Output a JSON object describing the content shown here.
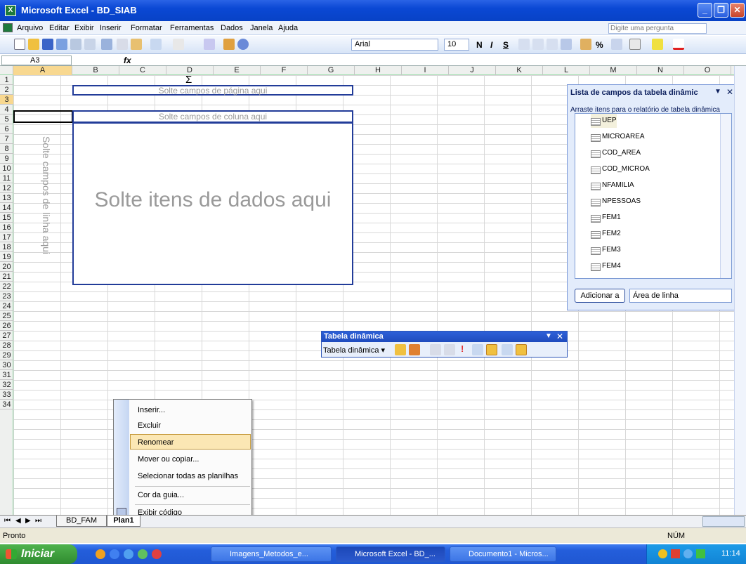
{
  "window": {
    "title": "Microsoft Excel - BD_SIAB"
  },
  "menu": {
    "items": [
      "Arquivo",
      "Editar",
      "Exibir",
      "Inserir",
      "Formatar",
      "Ferramentas",
      "Dados",
      "Janela",
      "Ajuda"
    ],
    "help_placeholder": "Digite uma pergunta"
  },
  "toolbar": {
    "font": "Arial",
    "size": "10",
    "bold": "N",
    "italic": "I",
    "underline": "S",
    "percent": "%"
  },
  "formula": {
    "cell": "A3",
    "fx": "fx"
  },
  "columns": [
    "A",
    "B",
    "C",
    "D",
    "E",
    "F",
    "G",
    "H",
    "I",
    "J",
    "K",
    "L",
    "M",
    "N",
    "O"
  ],
  "rows": [
    "1",
    "2",
    "3",
    "4",
    "5",
    "6",
    "7",
    "8",
    "9",
    "10",
    "11",
    "12",
    "13",
    "14",
    "15",
    "16",
    "17",
    "18",
    "19",
    "20",
    "21",
    "22",
    "23",
    "24",
    "25",
    "26",
    "27",
    "28",
    "29",
    "30",
    "31",
    "32",
    "33",
    "34"
  ],
  "pivot": {
    "page_drop": "Solte campos de página aqui",
    "column_drop": "Solte campos de coluna aqui",
    "row_drop": "Solte campos de linha aqui",
    "data_drop": "Solte itens de dados aqui"
  },
  "field_panel": {
    "title": "Lista de campos da tabela dinâmic",
    "instruction": "Arraste itens para o relatório de tabela dinâmica",
    "fields": [
      "UEP",
      "MICROAREA",
      "COD_AREA",
      "COD_MICROA",
      "NFAMILIA",
      "NPESSOAS",
      "FEM1",
      "FEM2",
      "FEM3",
      "FEM4"
    ],
    "add_button": "Adicionar a",
    "area": "Área de linha"
  },
  "pivot_toolbar": {
    "title": "Tabela dinâmica",
    "menu": "Tabela dinâmica ▾"
  },
  "context_menu": {
    "items": [
      "Inserir...",
      "Excluir",
      "Renomear",
      "Mover ou copiar...",
      "Selecionar todas as planilhas",
      "Cor da guia...",
      "Exibir código"
    ]
  },
  "sheets": {
    "tabs": [
      "BD_FAM",
      "Plan1"
    ]
  },
  "status": {
    "left": "Pronto",
    "num": "NÚM"
  },
  "taskbar": {
    "start": "Iniciar",
    "tasks": [
      "Imagens_Metodos_e...",
      "Microsoft Excel - BD_...",
      "Documento1 - Micros..."
    ],
    "clock": "11:14"
  }
}
